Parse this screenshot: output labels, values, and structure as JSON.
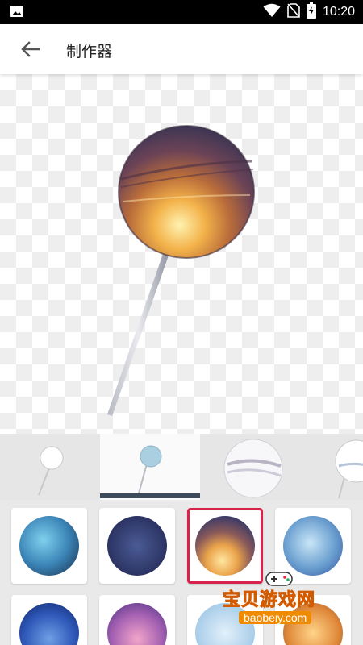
{
  "status_bar": {
    "time": "10:20",
    "icons": [
      "image-icon",
      "wifi-icon",
      "no-sim-icon",
      "battery-charging-icon"
    ]
  },
  "app_bar": {
    "title": "制作器",
    "back_icon": "arrow-left-icon"
  },
  "editor": {
    "preview": "lollipop-sunset"
  },
  "thumbnails": [
    {
      "name": "lollipop-white-small",
      "selected": false
    },
    {
      "name": "lollipop-blue-small",
      "selected": true
    },
    {
      "name": "candy-ball-white",
      "selected": false
    },
    {
      "name": "lollipop-white-partial",
      "selected": false
    }
  ],
  "textures": [
    {
      "name": "texture-sky-blue",
      "selected": false
    },
    {
      "name": "texture-navy",
      "selected": false
    },
    {
      "name": "texture-sunset",
      "selected": true
    },
    {
      "name": "texture-ice-blue",
      "selected": false
    },
    {
      "name": "texture-deep-blue",
      "selected": false
    },
    {
      "name": "texture-pink-purple",
      "selected": false
    },
    {
      "name": "texture-light-blue",
      "selected": false
    },
    {
      "name": "texture-orange",
      "selected": false
    }
  ],
  "watermark": {
    "text": "宝贝游戏网",
    "url": "baobeiy.com"
  },
  "colors": {
    "accent": "#d8234a",
    "tab_indicator": "#3d4a5a"
  }
}
